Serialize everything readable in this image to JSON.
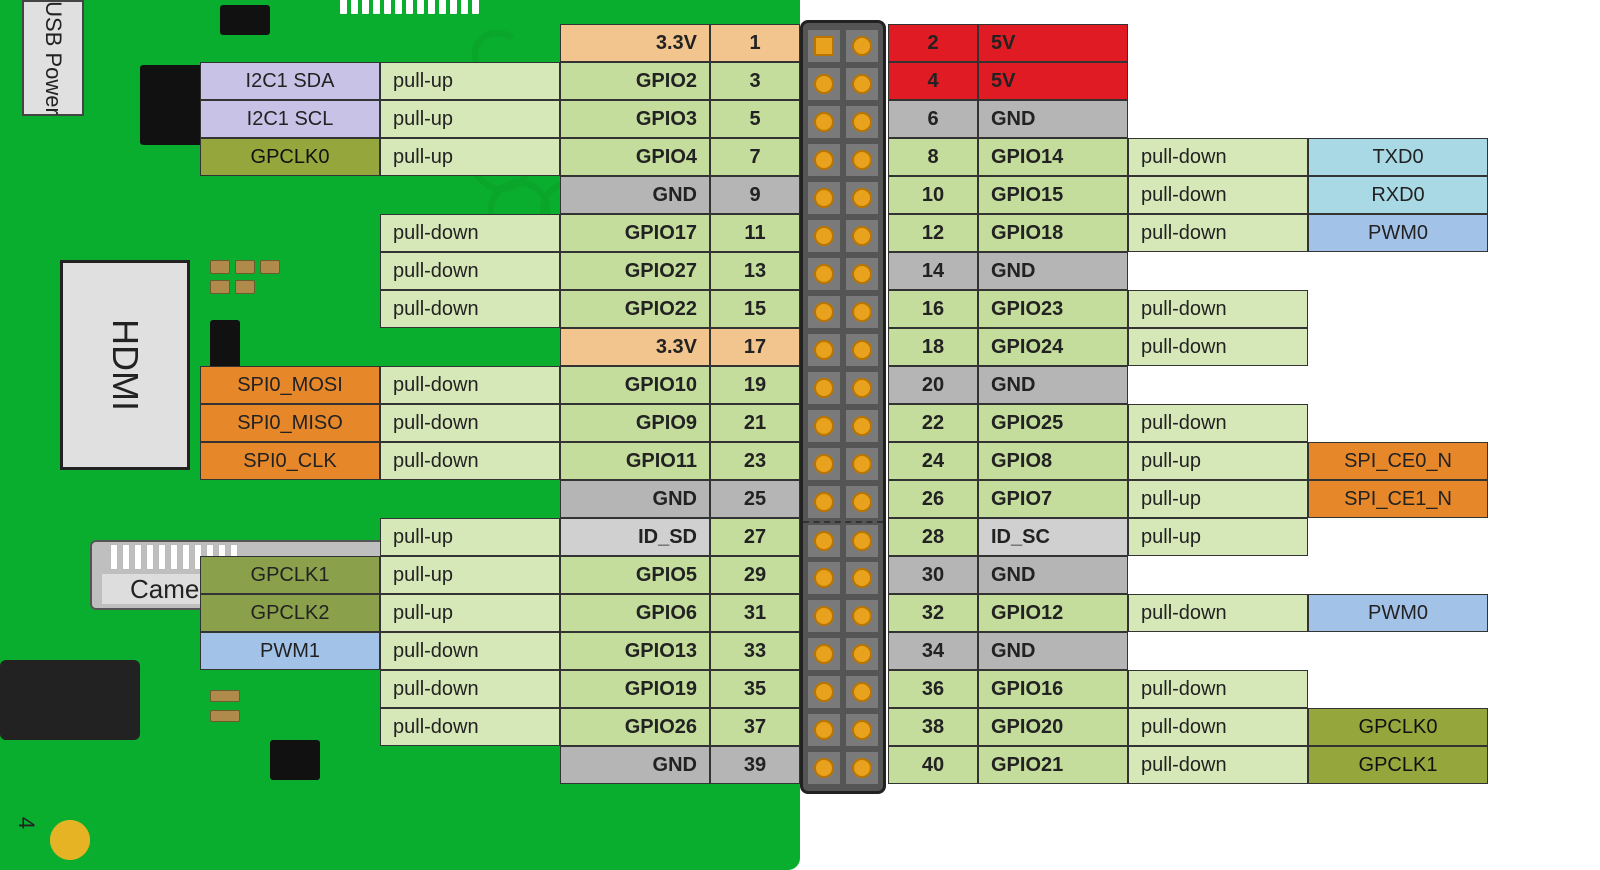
{
  "board": {
    "usb_label": "USB Power",
    "hdmi_label": "HDMI",
    "camera_label": "Came",
    "corner_num": "4"
  },
  "pins_left": [
    {
      "num": 1,
      "name": "3.3V",
      "name_cls": "c-3v3",
      "num_cls": "c-3v3"
    },
    {
      "num": 3,
      "name": "GPIO2",
      "pull": "pull-up",
      "alt": "I2C1 SDA",
      "alt_cls": "c-alt-i2c"
    },
    {
      "num": 5,
      "name": "GPIO3",
      "pull": "pull-up",
      "alt": "I2C1 SCL",
      "alt_cls": "c-alt-i2c"
    },
    {
      "num": 7,
      "name": "GPIO4",
      "pull": "pull-up",
      "alt": "GPCLK0",
      "alt_cls": "c-alt-clk"
    },
    {
      "num": 9,
      "name": "GND",
      "name_cls": "c-gnd",
      "num_cls": "c-gnd"
    },
    {
      "num": 11,
      "name": "GPIO17",
      "pull": "pull-down"
    },
    {
      "num": 13,
      "name": "GPIO27",
      "pull": "pull-down"
    },
    {
      "num": 15,
      "name": "GPIO22",
      "pull": "pull-down"
    },
    {
      "num": 17,
      "name": "3.3V",
      "name_cls": "c-3v3",
      "num_cls": "c-3v3"
    },
    {
      "num": 19,
      "name": "GPIO10",
      "pull": "pull-down",
      "alt": "SPI0_MOSI",
      "alt_cls": "c-alt-spi"
    },
    {
      "num": 21,
      "name": "GPIO9",
      "pull": "pull-down",
      "alt": "SPI0_MISO",
      "alt_cls": "c-alt-spi"
    },
    {
      "num": 23,
      "name": "GPIO11",
      "pull": "pull-down",
      "alt": "SPI0_CLK",
      "alt_cls": "c-alt-spi"
    },
    {
      "num": 25,
      "name": "GND",
      "name_cls": "c-gnd",
      "num_cls": "c-gnd"
    },
    {
      "num": 27,
      "name": "ID_SD",
      "name_cls": "c-idsd",
      "pull": "pull-up"
    },
    {
      "num": 29,
      "name": "GPIO5",
      "pull": "pull-up",
      "alt": "GPCLK1",
      "alt_cls": "c-alt-grn"
    },
    {
      "num": 31,
      "name": "GPIO6",
      "pull": "pull-up",
      "alt": "GPCLK2",
      "alt_cls": "c-alt-grn"
    },
    {
      "num": 33,
      "name": "GPIO13",
      "pull": "pull-down",
      "alt": "PWM1",
      "alt_cls": "c-alt-pwm"
    },
    {
      "num": 35,
      "name": "GPIO19",
      "pull": "pull-down"
    },
    {
      "num": 37,
      "name": "GPIO26",
      "pull": "pull-down"
    },
    {
      "num": 39,
      "name": "GND",
      "name_cls": "c-gnd",
      "num_cls": "c-gnd"
    }
  ],
  "pins_right": [
    {
      "num": 2,
      "name": "5V",
      "name_cls": "c-5v",
      "num_cls": "c-5v"
    },
    {
      "num": 4,
      "name": "5V",
      "name_cls": "c-5v",
      "num_cls": "c-5v"
    },
    {
      "num": 6,
      "name": "GND",
      "name_cls": "c-gnd",
      "num_cls": "c-gnd"
    },
    {
      "num": 8,
      "name": "GPIO14",
      "pull": "pull-down",
      "alt": "TXD0",
      "alt_cls": "c-alt-uart"
    },
    {
      "num": 10,
      "name": "GPIO15",
      "pull": "pull-down",
      "alt": "RXD0",
      "alt_cls": "c-alt-uart"
    },
    {
      "num": 12,
      "name": "GPIO18",
      "pull": "pull-down",
      "alt": "PWM0",
      "alt_cls": "c-alt-pwm"
    },
    {
      "num": 14,
      "name": "GND",
      "name_cls": "c-gnd",
      "num_cls": "c-gnd"
    },
    {
      "num": 16,
      "name": "GPIO23",
      "pull": "pull-down"
    },
    {
      "num": 18,
      "name": "GPIO24",
      "pull": "pull-down"
    },
    {
      "num": 20,
      "name": "GND",
      "name_cls": "c-gnd",
      "num_cls": "c-gnd"
    },
    {
      "num": 22,
      "name": "GPIO25",
      "pull": "pull-down"
    },
    {
      "num": 24,
      "name": "GPIO8",
      "pull": "pull-up",
      "alt": "SPI_CE0_N",
      "alt_cls": "c-alt-spi"
    },
    {
      "num": 26,
      "name": "GPIO7",
      "pull": "pull-up",
      "alt": "SPI_CE1_N",
      "alt_cls": "c-alt-spi"
    },
    {
      "num": 28,
      "name": "ID_SC",
      "name_cls": "c-idsd",
      "pull": "pull-up"
    },
    {
      "num": 30,
      "name": "GND",
      "name_cls": "c-gnd",
      "num_cls": "c-gnd"
    },
    {
      "num": 32,
      "name": "GPIO12",
      "pull": "pull-down",
      "alt": "PWM0",
      "alt_cls": "c-alt-pwm"
    },
    {
      "num": 34,
      "name": "GND",
      "name_cls": "c-gnd",
      "num_cls": "c-gnd"
    },
    {
      "num": 36,
      "name": "GPIO16",
      "pull": "pull-down"
    },
    {
      "num": 38,
      "name": "GPIO20",
      "pull": "pull-down",
      "alt": "GPCLK0",
      "alt_cls": "c-alt-clk"
    },
    {
      "num": 40,
      "name": "GPIO21",
      "pull": "pull-down",
      "alt": "GPCLK1",
      "alt_cls": "c-alt-clk"
    }
  ]
}
